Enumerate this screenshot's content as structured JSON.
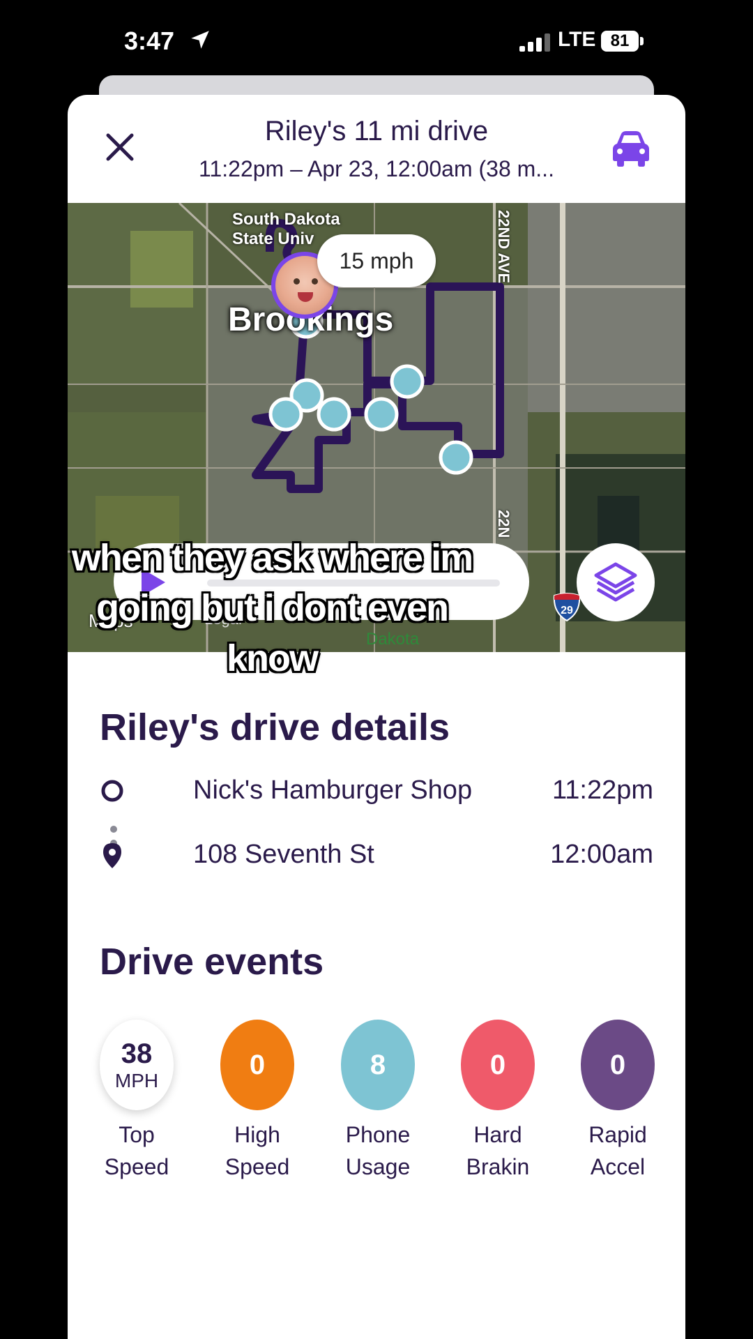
{
  "status_bar": {
    "time": "3:47",
    "network": "LTE",
    "battery": "81"
  },
  "header": {
    "title": "Riley's 11 mi drive",
    "subtitle": "11:22pm – Apr 23, 12:00am (38 m..."
  },
  "map": {
    "speed": "15 mph",
    "place_label": "Brookings",
    "poi_label_line1": "South Dakota",
    "poi_label_line2": "State Univ",
    "road_label": "22ND AVE",
    "road_label_2": "22N",
    "interstate": "29",
    "attribution": "Maps",
    "legal": "Legal",
    "bottom_label": "Dakota"
  },
  "caption": "when they ask where im going but i dont even know",
  "details": {
    "title": "Riley's drive details",
    "stops": [
      {
        "name": "Nick's Hamburger Shop",
        "time": "11:22pm"
      },
      {
        "name": "108 Seventh St",
        "time": "12:00am"
      }
    ]
  },
  "events": {
    "title": "Drive events",
    "items": [
      {
        "value": "38",
        "unit": "MPH",
        "label_line1": "Top",
        "label_line2": "Speed",
        "color": "#ffffff"
      },
      {
        "value": "0",
        "label_line1": "High",
        "label_line2": "Speed",
        "color": "#f07d12"
      },
      {
        "value": "8",
        "label_line1": "Phone",
        "label_line2": "Usage",
        "color": "#7ec4d3"
      },
      {
        "value": "0",
        "label_line1": "Hard",
        "label_line2": "Brakin",
        "color": "#ef5a6a"
      },
      {
        "value": "0",
        "label_line1": "Rapid",
        "label_line2": "Accel",
        "color": "#6b4a86"
      }
    ]
  },
  "colors": {
    "accent": "#7b45e8",
    "text": "#2a1a4a",
    "route": "#2b1457"
  }
}
